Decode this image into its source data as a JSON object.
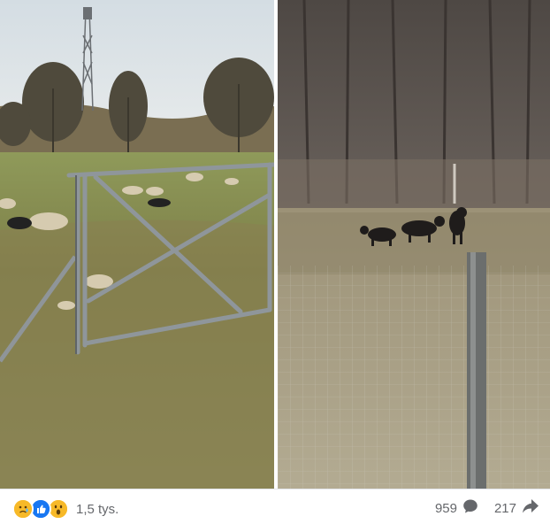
{
  "post": {
    "images": [
      {
        "icon": "photo-gate-field",
        "alt": ""
      },
      {
        "icon": "photo-wolves-fence",
        "alt": ""
      }
    ],
    "reactions": {
      "icons": [
        "sad-reaction-icon",
        "like-reaction-icon",
        "wow-reaction-icon"
      ],
      "count_label": "1,5 tys."
    },
    "comments": {
      "count": "959",
      "icon": "comment-icon"
    },
    "shares": {
      "count": "217",
      "icon": "share-icon"
    }
  },
  "colors": {
    "like_blue": "#1877f2",
    "reaction_yellow": "#f7b928",
    "meta_gray": "#65676b"
  }
}
